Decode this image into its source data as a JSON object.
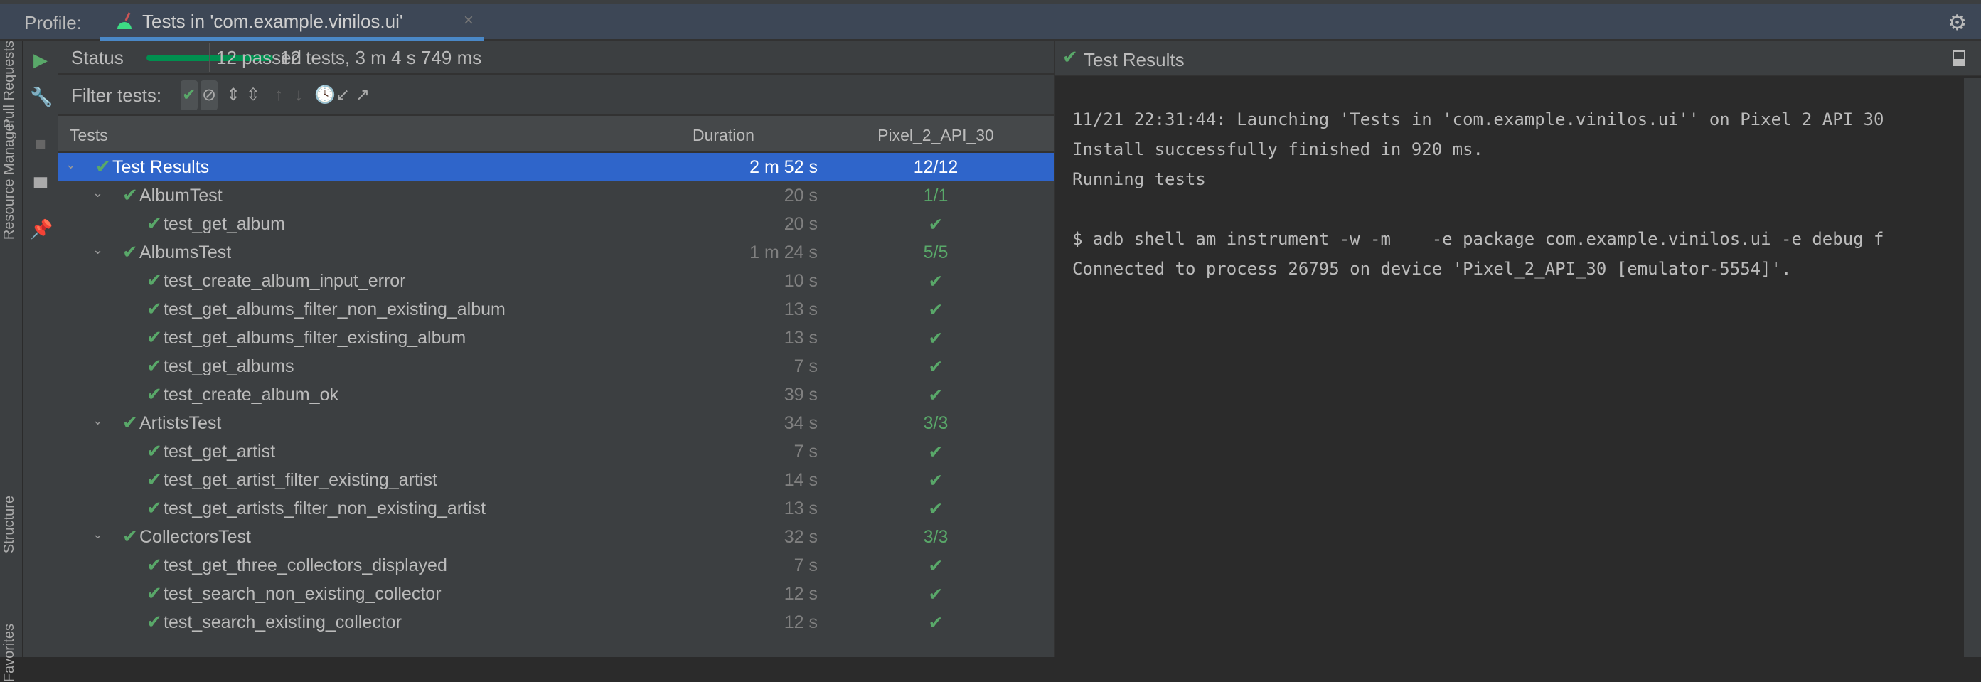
{
  "tabbar": {
    "profile_label": "Profile:",
    "tab_title": "Tests in 'com.example.vinilos.ui'"
  },
  "side_tabs": [
    "Pull Requests",
    "Resource Manager",
    "Structure",
    "Favorites"
  ],
  "status": {
    "label": "Status",
    "progress_percent": 100,
    "passed": "12 passed",
    "summary": "12 tests, 3 m 4 s 749 ms"
  },
  "filter": {
    "label": "Filter tests:"
  },
  "columns": {
    "tests": "Tests",
    "duration": "Duration",
    "device": "Pixel_2_API_30"
  },
  "rows": [
    {
      "level": 0,
      "name": "Test Results",
      "duration": "2 m 52 s",
      "device": "12/12",
      "expandable": true
    },
    {
      "level": 1,
      "name": "AlbumTest",
      "duration": "20 s",
      "device": "1/1",
      "expandable": true
    },
    {
      "level": 2,
      "name": "test_get_album",
      "duration": "20 s",
      "device": "✔"
    },
    {
      "level": 1,
      "name": "AlbumsTest",
      "duration": "1 m 24 s",
      "device": "5/5",
      "expandable": true
    },
    {
      "level": 2,
      "name": "test_create_album_input_error",
      "duration": "10 s",
      "device": "✔"
    },
    {
      "level": 2,
      "name": "test_get_albums_filter_non_existing_album",
      "duration": "13 s",
      "device": "✔"
    },
    {
      "level": 2,
      "name": "test_get_albums_filter_existing_album",
      "duration": "13 s",
      "device": "✔"
    },
    {
      "level": 2,
      "name": "test_get_albums",
      "duration": "7 s",
      "device": "✔"
    },
    {
      "level": 2,
      "name": "test_create_album_ok",
      "duration": "39 s",
      "device": "✔"
    },
    {
      "level": 1,
      "name": "ArtistsTest",
      "duration": "34 s",
      "device": "3/3",
      "expandable": true
    },
    {
      "level": 2,
      "name": "test_get_artist",
      "duration": "7 s",
      "device": "✔"
    },
    {
      "level": 2,
      "name": "test_get_artist_filter_existing_artist",
      "duration": "14 s",
      "device": "✔"
    },
    {
      "level": 2,
      "name": "test_get_artists_filter_non_existing_artist",
      "duration": "13 s",
      "device": "✔"
    },
    {
      "level": 1,
      "name": "CollectorsTest",
      "duration": "32 s",
      "device": "3/3",
      "expandable": true
    },
    {
      "level": 2,
      "name": "test_get_three_collectors_displayed",
      "duration": "7 s",
      "device": "✔"
    },
    {
      "level": 2,
      "name": "test_search_non_existing_collector",
      "duration": "12 s",
      "device": "✔"
    },
    {
      "level": 2,
      "name": "test_search_existing_collector",
      "duration": "12 s",
      "device": "✔"
    }
  ],
  "console": {
    "title": "Test Results",
    "lines": [
      "11/21 22:31:44: Launching 'Tests in 'com.example.vinilos.ui'' on Pixel 2 API 30",
      "Install successfully finished in 920 ms.",
      "Running tests",
      "",
      "$ adb shell am instrument -w -m    -e package com.example.vinilos.ui -e debug f",
      "Connected to process 26795 on device 'Pixel_2_API_30 [emulator-5554]'."
    ]
  },
  "colors": {
    "pass": "#59a869",
    "selection": "#2f65ca",
    "progress": "#008f4f",
    "tab_underline": "#4a88c7"
  }
}
